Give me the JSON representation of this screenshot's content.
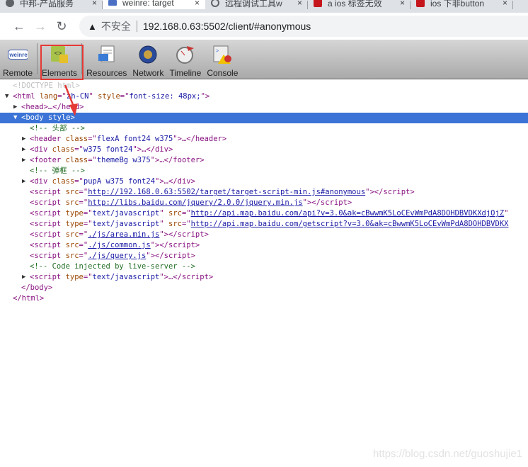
{
  "browser": {
    "tabs": [
      {
        "title": "中邦-产品服务",
        "icon": "globe-icon",
        "active": false
      },
      {
        "title": "weinre: target",
        "icon": "document-icon",
        "active": true
      },
      {
        "title": "远程调试工具w",
        "icon": "search-icon",
        "active": false
      },
      {
        "title": "a ios 标签无效",
        "icon": "csdn-icon",
        "active": false
      },
      {
        "title": "ios 下非button",
        "icon": "csdn-icon",
        "active": false
      }
    ],
    "close_glyph": "×",
    "security_label": "不安全",
    "url": "192.168.0.63:5502/client/#anonymous"
  },
  "toolbar": {
    "items": [
      {
        "label": "Remote",
        "icon": "weinre-icon"
      },
      {
        "label": "Elements",
        "icon": "elements-icon",
        "highlighted": true
      },
      {
        "label": "Resources",
        "icon": "resources-icon"
      },
      {
        "label": "Network",
        "icon": "network-icon"
      },
      {
        "label": "Timeline",
        "icon": "timeline-icon"
      },
      {
        "label": "Console",
        "icon": "console-icon"
      }
    ],
    "logo_text": "weinre",
    "highlight_color": "#e53935"
  },
  "dom_tree": [
    {
      "indent": 18,
      "segs": [
        [
          "d",
          "<!DOCTYPE html>"
        ]
      ]
    },
    {
      "indent": 18,
      "arrow": "▼",
      "segs": [
        [
          "p",
          "<html "
        ],
        [
          "n",
          "lang"
        ],
        [
          "p",
          "=\""
        ],
        [
          "v",
          "zh-CN"
        ],
        [
          "p",
          "\" "
        ],
        [
          "n",
          "style"
        ],
        [
          "p",
          "=\""
        ],
        [
          "v",
          "font-size: 48px;"
        ],
        [
          "p",
          "\">"
        ]
      ]
    },
    {
      "indent": 30,
      "arrow": "▶",
      "segs": [
        [
          "p",
          "<head>…</head>"
        ]
      ]
    },
    {
      "indent": 30,
      "arrow": "▼",
      "selected": true,
      "segs": [
        [
          "p",
          "<body "
        ],
        [
          "n",
          "style"
        ],
        [
          "p",
          ">"
        ]
      ]
    },
    {
      "indent": 42,
      "segs": [
        [
          "c",
          "<!-- 头部 -->"
        ]
      ]
    },
    {
      "indent": 42,
      "arrow": "▶",
      "segs": [
        [
          "p",
          "<header "
        ],
        [
          "n",
          "class"
        ],
        [
          "p",
          "=\""
        ],
        [
          "v",
          "flexA font24 w375"
        ],
        [
          "p",
          "\">…</header>"
        ]
      ]
    },
    {
      "indent": 42,
      "arrow": "▶",
      "segs": [
        [
          "p",
          "<div "
        ],
        [
          "n",
          "class"
        ],
        [
          "p",
          "=\""
        ],
        [
          "v",
          "w375 font24"
        ],
        [
          "p",
          "\">…</div>"
        ]
      ]
    },
    {
      "indent": 42,
      "arrow": "▶",
      "segs": [
        [
          "p",
          "<footer "
        ],
        [
          "n",
          "class"
        ],
        [
          "p",
          "=\""
        ],
        [
          "v",
          "themeBg w375"
        ],
        [
          "p",
          "\">…</footer>"
        ]
      ]
    },
    {
      "indent": 42,
      "segs": [
        [
          "c",
          "<!-- 弹框 -->"
        ]
      ]
    },
    {
      "indent": 42,
      "arrow": "▶",
      "segs": [
        [
          "p",
          "<div "
        ],
        [
          "n",
          "class"
        ],
        [
          "p",
          "=\""
        ],
        [
          "v",
          "pupA w375 font24"
        ],
        [
          "p",
          "\">…</div>"
        ]
      ]
    },
    {
      "indent": 42,
      "segs": [
        [
          "p",
          "<script "
        ],
        [
          "n",
          "src"
        ],
        [
          "p",
          "=\""
        ],
        [
          "l",
          "http://192.168.0.63:5502/target/target-script-min.js#anonymous"
        ],
        [
          "p",
          "\"></script>"
        ]
      ]
    },
    {
      "indent": 42,
      "segs": [
        [
          "p",
          "<script "
        ],
        [
          "n",
          "src"
        ],
        [
          "p",
          "=\""
        ],
        [
          "l",
          "http://libs.baidu.com/jquery/2.0.0/jquery.min.js"
        ],
        [
          "p",
          "\"></script>"
        ]
      ]
    },
    {
      "indent": 42,
      "segs": [
        [
          "p",
          "<script "
        ],
        [
          "n",
          "type"
        ],
        [
          "p",
          "=\""
        ],
        [
          "v",
          "text/javascript"
        ],
        [
          "p",
          "\" "
        ],
        [
          "n",
          "src"
        ],
        [
          "p",
          "=\""
        ],
        [
          "l",
          "http://api.map.baidu.com/api?v=3.0&ak=cBwwmK5LoCEvWmPdA8DOHDBVDKXdjOjZ"
        ],
        [
          "p",
          "\""
        ]
      ]
    },
    {
      "indent": 42,
      "segs": [
        [
          "p",
          "<script "
        ],
        [
          "n",
          "type"
        ],
        [
          "p",
          "=\""
        ],
        [
          "v",
          "text/javascript"
        ],
        [
          "p",
          "\" "
        ],
        [
          "n",
          "src"
        ],
        [
          "p",
          "=\""
        ],
        [
          "l",
          "http://api.map.baidu.com/getscript?v=3.0&ak=cBwwmK5LoCEvWmPdA8DOHDBVDKX"
        ]
      ]
    },
    {
      "indent": 42,
      "segs": [
        [
          "p",
          "<script "
        ],
        [
          "n",
          "src"
        ],
        [
          "p",
          "=\""
        ],
        [
          "l",
          "./js/area.min.js"
        ],
        [
          "p",
          "\"></script>"
        ]
      ]
    },
    {
      "indent": 42,
      "segs": [
        [
          "p",
          "<script "
        ],
        [
          "n",
          "src"
        ],
        [
          "p",
          "=\""
        ],
        [
          "l",
          "./js/common.js"
        ],
        [
          "p",
          "\"></script>"
        ]
      ]
    },
    {
      "indent": 42,
      "segs": [
        [
          "p",
          "<script "
        ],
        [
          "n",
          "src"
        ],
        [
          "p",
          "=\""
        ],
        [
          "l",
          "./js/query.js"
        ],
        [
          "p",
          "\"></script>"
        ]
      ]
    },
    {
      "indent": 42,
      "segs": [
        [
          "c",
          "<!-- Code injected by live-server -->"
        ]
      ]
    },
    {
      "indent": 42,
      "arrow": "▶",
      "segs": [
        [
          "p",
          "<script "
        ],
        [
          "n",
          "type"
        ],
        [
          "p",
          "=\""
        ],
        [
          "v",
          "text/javascript"
        ],
        [
          "p",
          "\">…</script>"
        ]
      ]
    },
    {
      "indent": 30,
      "segs": [
        [
          "p",
          "</body>"
        ]
      ]
    },
    {
      "indent": 18,
      "segs": [
        [
          "p",
          "</html>"
        ]
      ]
    }
  ],
  "watermark": "https://blog.csdn.net/guoshujie1"
}
